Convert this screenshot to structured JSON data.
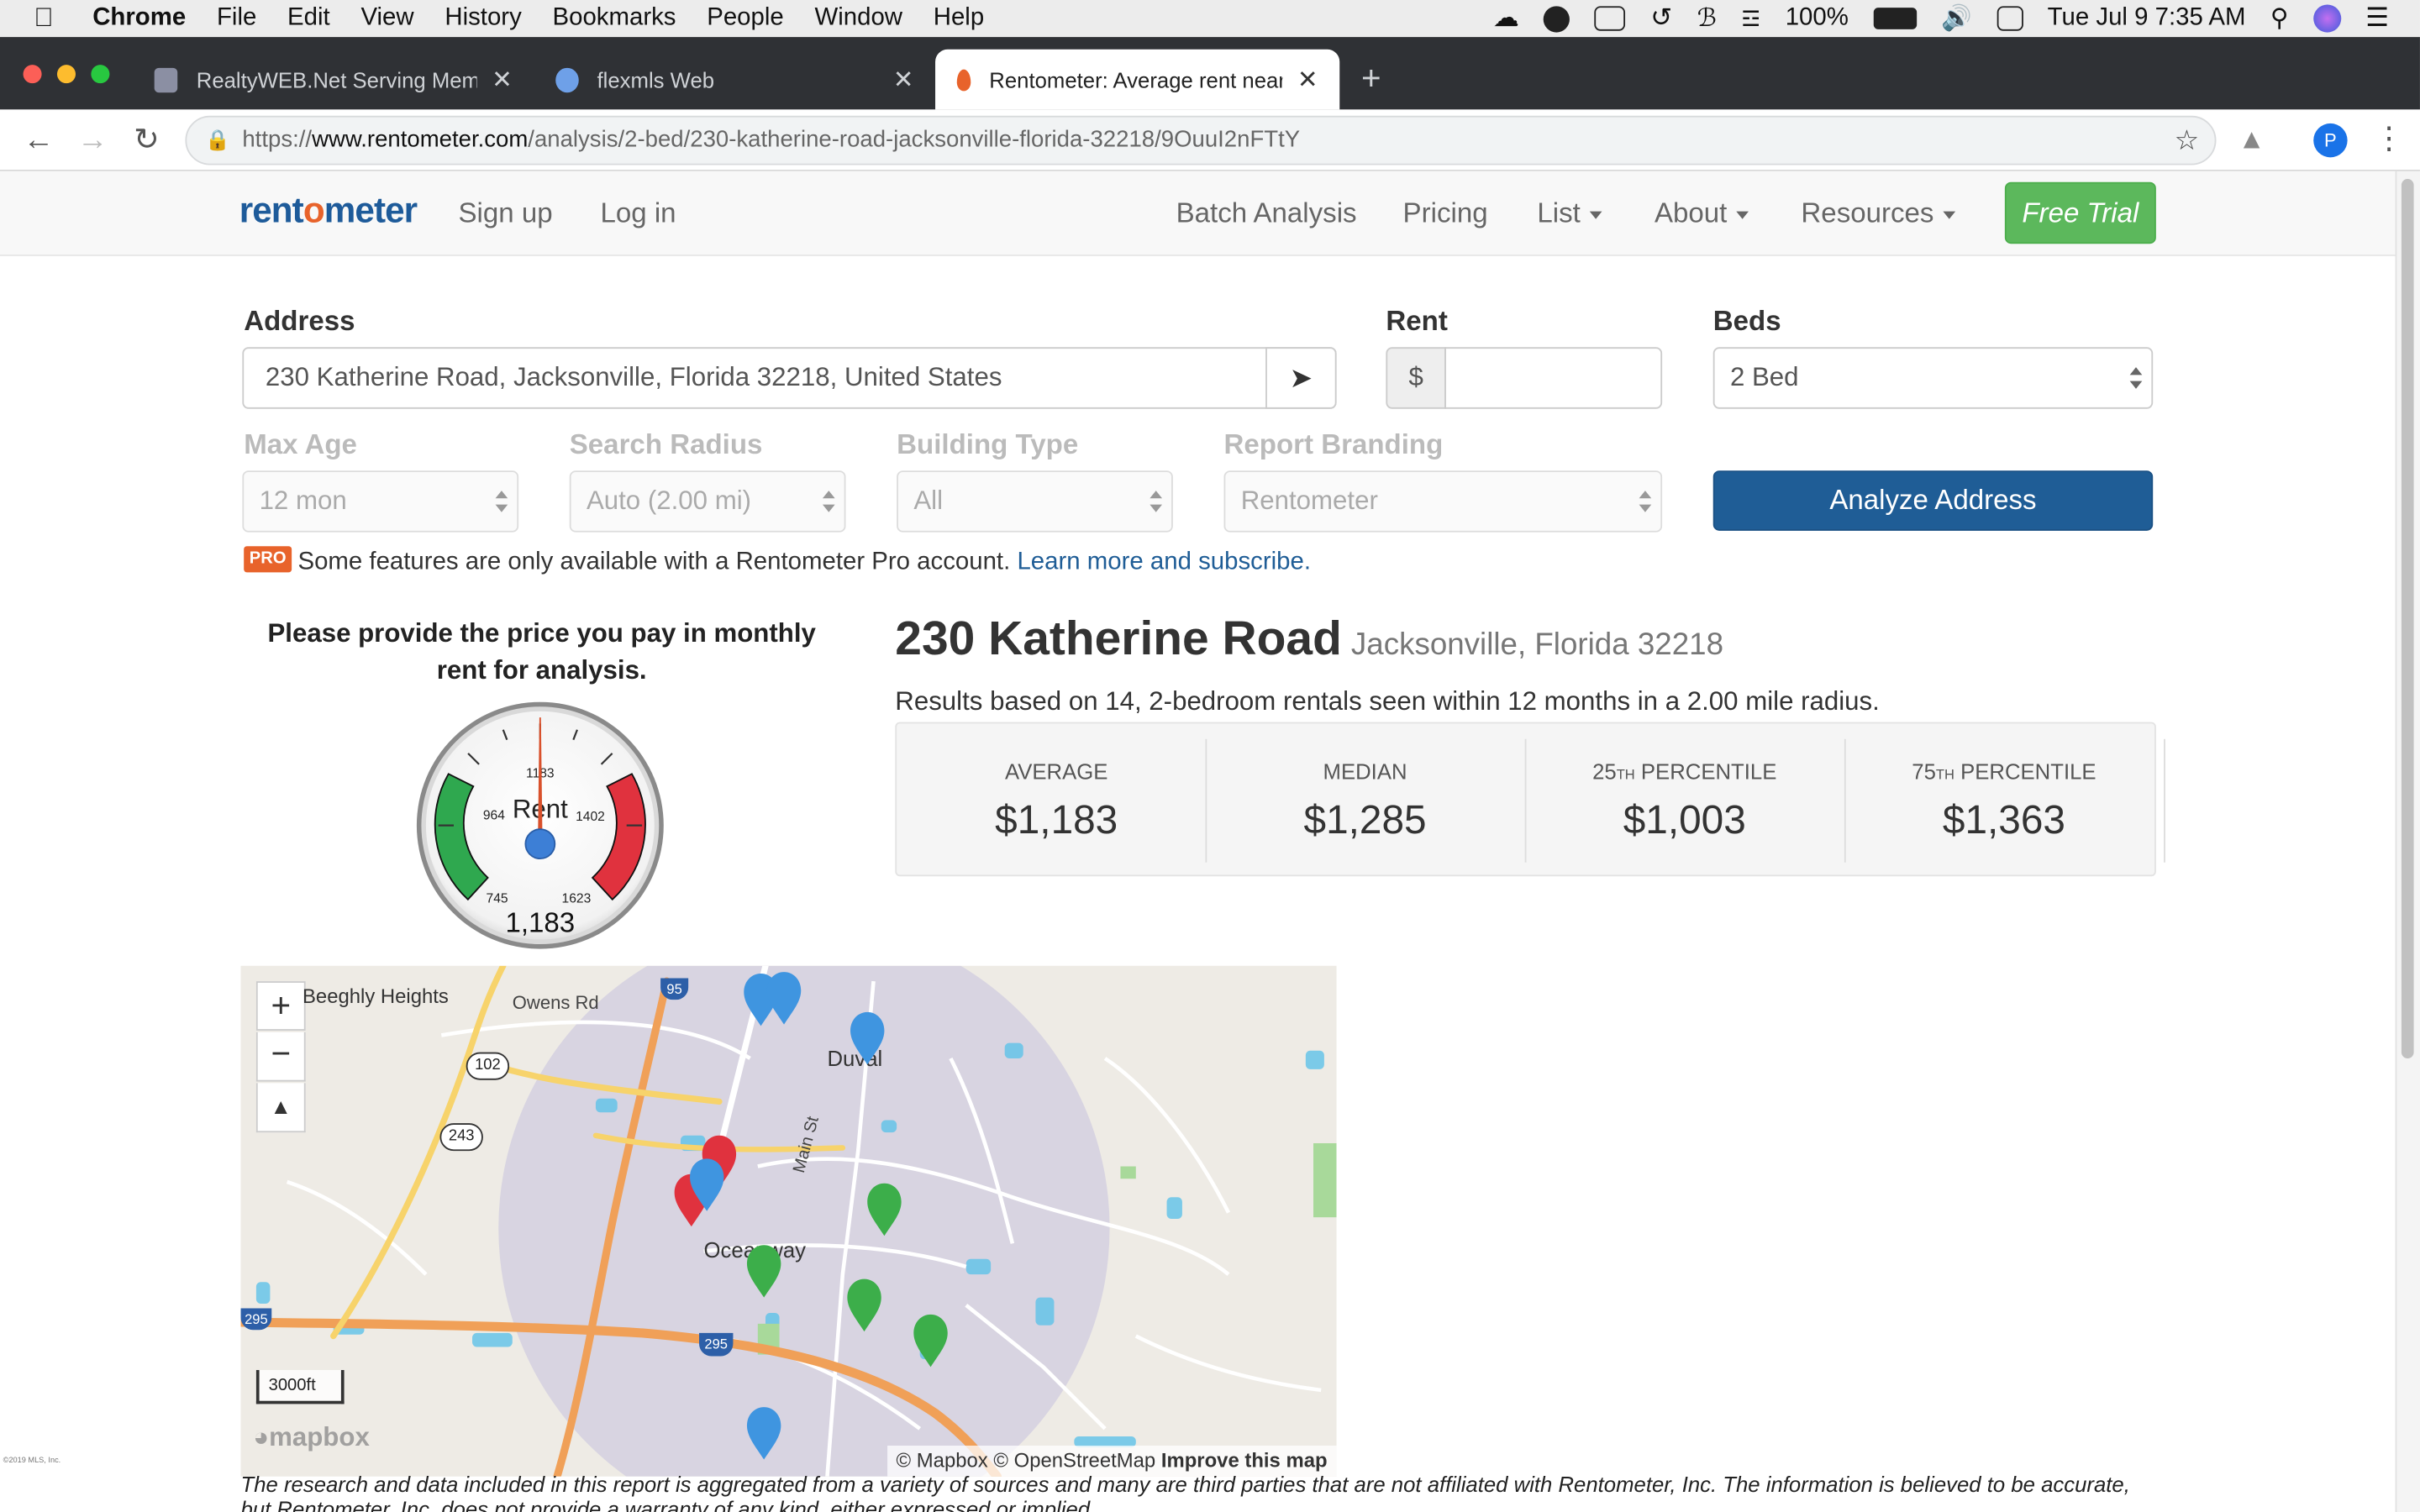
{
  "menubar": {
    "app": "Chrome",
    "items": [
      "File",
      "Edit",
      "View",
      "History",
      "Bookmarks",
      "People",
      "Window",
      "Help"
    ],
    "battery": "100%",
    "clock": "Tue Jul 9  7:35 AM"
  },
  "tabs": [
    {
      "title": "RealtyWEB.Net Serving Membe"
    },
    {
      "title": "flexmls Web"
    },
    {
      "title": "Rentometer: Average rent near"
    }
  ],
  "omnibox": {
    "scheme": "https://",
    "host": "www.rentometer.com",
    "path": "/analysis/2-bed/230-katherine-road-jacksonville-florida-32218/9OuuI2nFTtY"
  },
  "site": {
    "logo": "rentometer",
    "logo_prefix": "rent",
    "logo_o": "o",
    "logo_suffix": "meter",
    "nav": {
      "signup": "Sign up",
      "login": "Log in",
      "batch": "Batch Analysis",
      "pricing": "Pricing",
      "list": "List",
      "about": "About",
      "resources": "Resources",
      "free_trial": "Free Trial"
    }
  },
  "form": {
    "address_label": "Address",
    "address_value": "230 Katherine Road, Jacksonville, Florida 32218, United States",
    "rent_label": "Rent",
    "rent_currency": "$",
    "rent_value": "",
    "beds_label": "Beds",
    "beds_value": "2 Bed",
    "max_age_label": "Max Age",
    "max_age_value": "12 mon",
    "radius_label": "Search Radius",
    "radius_value": "Auto (2.00 mi)",
    "building_label": "Building Type",
    "building_value": "All",
    "branding_label": "Report Branding",
    "branding_value": "Rentometer",
    "analyze_button": "Analyze Address",
    "pro_badge": "PRO",
    "pro_note": "Some features are only available with a Rentometer Pro account.",
    "pro_link": "Learn more and subscribe."
  },
  "gauge": {
    "prompt": "Please provide the price you pay in monthly rent for analysis.",
    "center_label": "Rent",
    "ticks": [
      "745",
      "964",
      "1183",
      "1402",
      "1623"
    ],
    "value": "1,183"
  },
  "report": {
    "street": "230 Katherine Road",
    "locality": "Jacksonville, Florida 32218",
    "summary": "Results based on 14, 2-bedroom rentals seen within 12 months in a 2.00 mile radius.",
    "stats": [
      {
        "label": "AVERAGE",
        "value": "$1,183"
      },
      {
        "label": "MEDIAN",
        "value": "$1,285"
      },
      {
        "label_prefix": "25",
        "label_sup": "TH",
        "label_suffix": " PERCENTILE",
        "value": "$1,003"
      },
      {
        "label_prefix": "75",
        "label_sup": "TH",
        "label_suffix": " PERCENTILE",
        "value": "$1,363"
      }
    ]
  },
  "map": {
    "labels": {
      "beeghly": "Beeghly Heights",
      "owens": "Owens Rd",
      "duval": "Duval",
      "main": "Main St",
      "oceanway": "Oceanway"
    },
    "shields": [
      "95",
      "102",
      "243",
      "295",
      "295"
    ],
    "scale": "3000ft",
    "attribution_mapbox": "© Mapbox",
    "attribution_osm": "© OpenStreetMap",
    "improve": "Improve this map",
    "logo": "mapbox"
  },
  "disclaimer": "The research and data included in this report is aggregated from a variety of sources and many are third parties that are not affiliated with Rentometer, Inc. The information is believed to be accurate, but Rentometer, Inc. does not provide a warranty of any kind, either expressed or implied.",
  "side_copyright": "©2019 MLS, Inc."
}
